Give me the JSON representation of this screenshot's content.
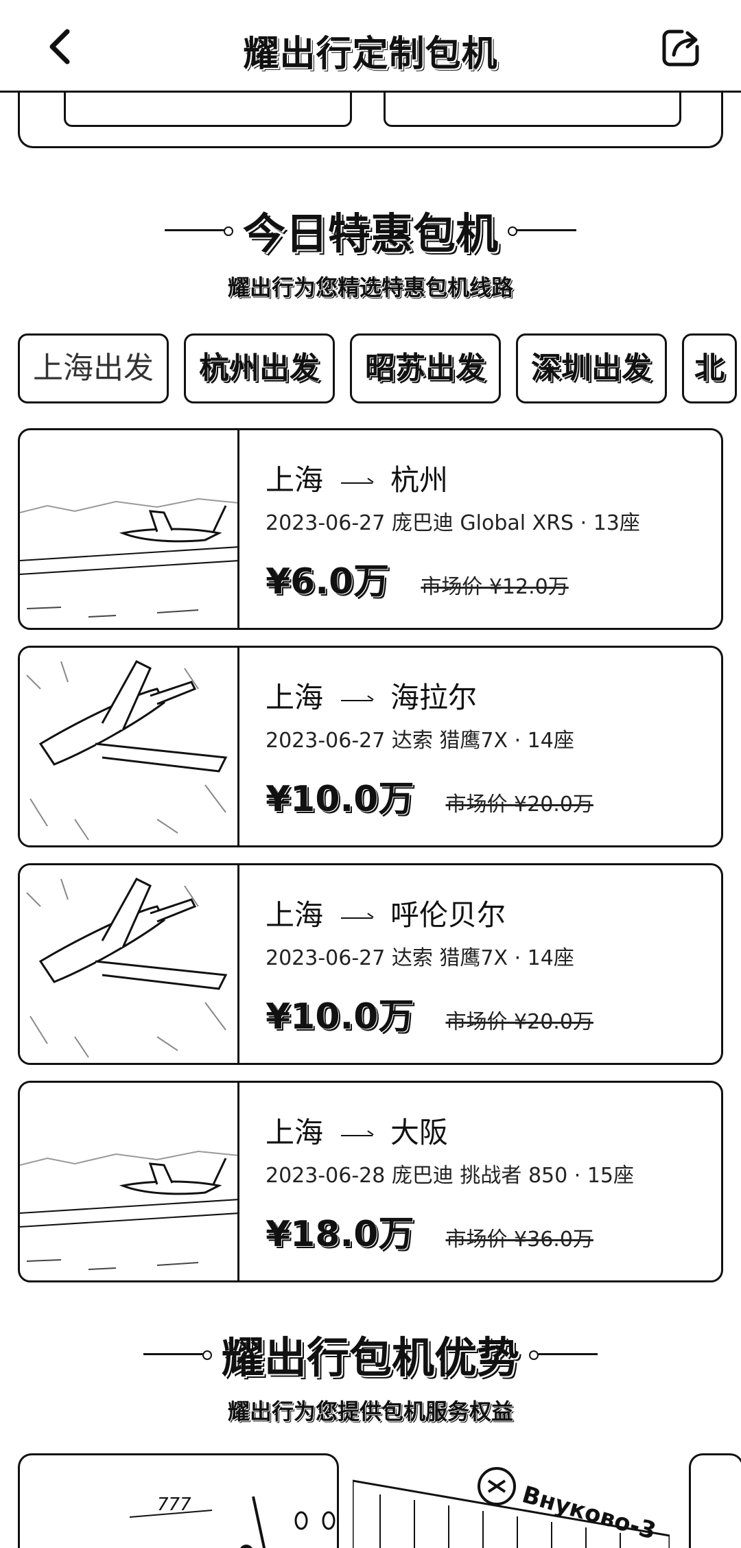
{
  "header": {
    "title": "耀出行定制包机",
    "back_icon": "chevron-left-icon",
    "share_icon": "share-icon"
  },
  "special": {
    "title": "今日特惠包机",
    "subtitle": "耀出行为您精选特惠包机线路"
  },
  "tabs": [
    {
      "label": "上海出发",
      "active": true
    },
    {
      "label": "杭州出发",
      "active": false
    },
    {
      "label": "昭苏出发",
      "active": false
    },
    {
      "label": "深圳出发",
      "active": false
    },
    {
      "label": "北",
      "active": false
    }
  ],
  "flights": [
    {
      "from": "上海",
      "to": "杭州",
      "meta": "2023-06-27 庞巴迪 Global XRS · 13座",
      "price": "¥6.0万",
      "market": "市场价 ¥12.0万",
      "image": "jet-runway-image"
    },
    {
      "from": "上海",
      "to": "海拉尔",
      "meta": "2023-06-27 达索 猎鹰7X · 14座",
      "price": "¥10.0万",
      "market": "市场价 ¥20.0万",
      "image": "jet-flying-image"
    },
    {
      "from": "上海",
      "to": "呼伦贝尔",
      "meta": "2023-06-27 达索 猎鹰7X · 14座",
      "price": "¥10.0万",
      "market": "市场价 ¥20.0万",
      "image": "jet-flying-image"
    },
    {
      "from": "上海",
      "to": "大阪",
      "meta": "2023-06-28 庞巴迪 挑战者 850 · 15座",
      "price": "¥18.0万",
      "market": "市场价 ¥36.0万",
      "image": "jet-runway-image"
    }
  ],
  "advantages": {
    "title": "耀出行包机优势",
    "subtitle": "耀出行为您提供包机服务权益",
    "terminal_sign": "Внуково-3"
  }
}
